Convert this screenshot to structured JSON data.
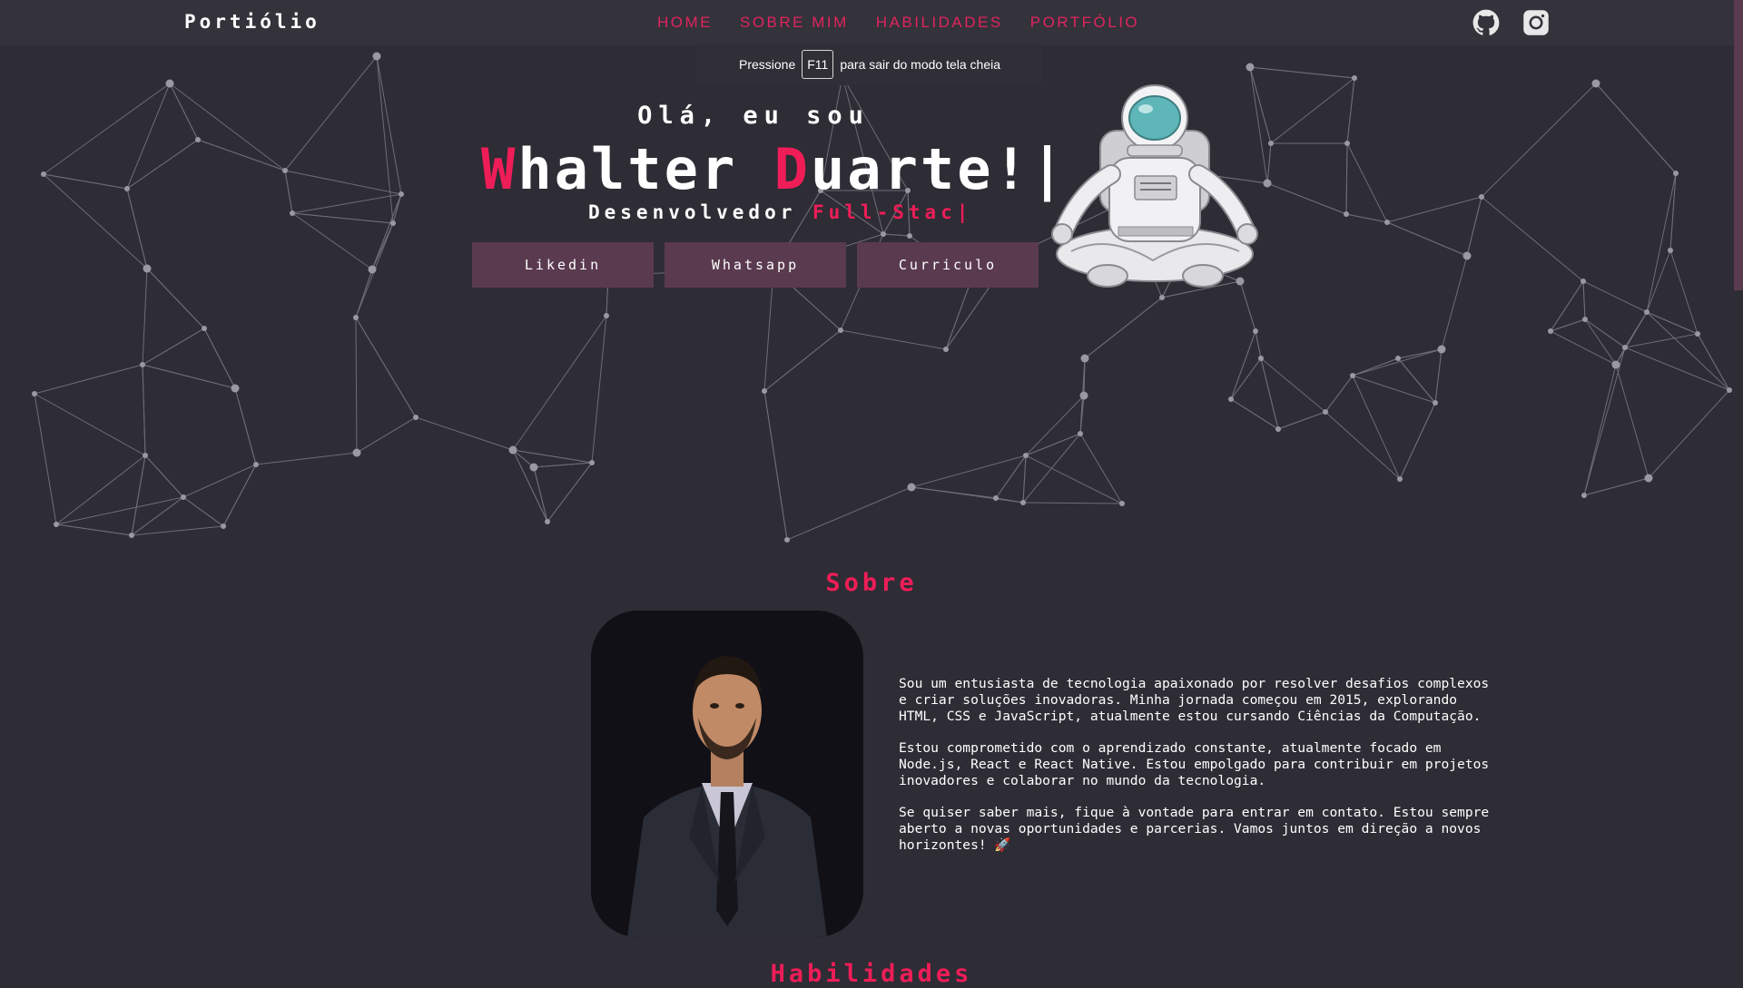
{
  "navbar": {
    "brand": "Portiólio",
    "links": [
      "HOME",
      "SOBRE MIM",
      "HABILIDADES",
      "PORTFÓLIO"
    ],
    "icons": [
      "github-icon",
      "instagram-icon"
    ]
  },
  "fullscreen_notice": {
    "before": "Pressione",
    "key": "F11",
    "after": "para sair do modo tela cheia"
  },
  "hero": {
    "greeting": "Olá, eu sou",
    "first_initial": "W",
    "first_rest": "halter ",
    "last_initial": "D",
    "last_rest": "uarte!|",
    "role_prefix": "Desenvolvedor ",
    "role_typed": "Full-Stac|",
    "buttons": [
      "Likedin",
      "Whatsapp",
      "Curriculo"
    ]
  },
  "about": {
    "title": "Sobre",
    "paragraphs": [
      "Sou um entusiasta de tecnologia apaixonado por resolver desafios complexos e criar soluções inovadoras. Minha jornada começou em 2015, explorando HTML, CSS e JavaScript, atualmente estou cursando Ciências da Computação.",
      "Estou comprometido com o aprendizado constante, atualmente focado em Node.js, React e React Native. Estou empolgado para contribuir em projetos inovadores e colaborar no mundo da tecnologia.",
      "Se quiser saber mais, fique à vontade para entrar em contato. Estou sempre aberto a novas oportunidades e parcerias. Vamos juntos em direção a novos horizontes! 🚀"
    ]
  },
  "skills": {
    "title": "Habilidades"
  },
  "colors": {
    "accent": "#ee1d58",
    "background": "#2e2c34",
    "navbar": "#34323a",
    "button": "#5a3a4e"
  }
}
